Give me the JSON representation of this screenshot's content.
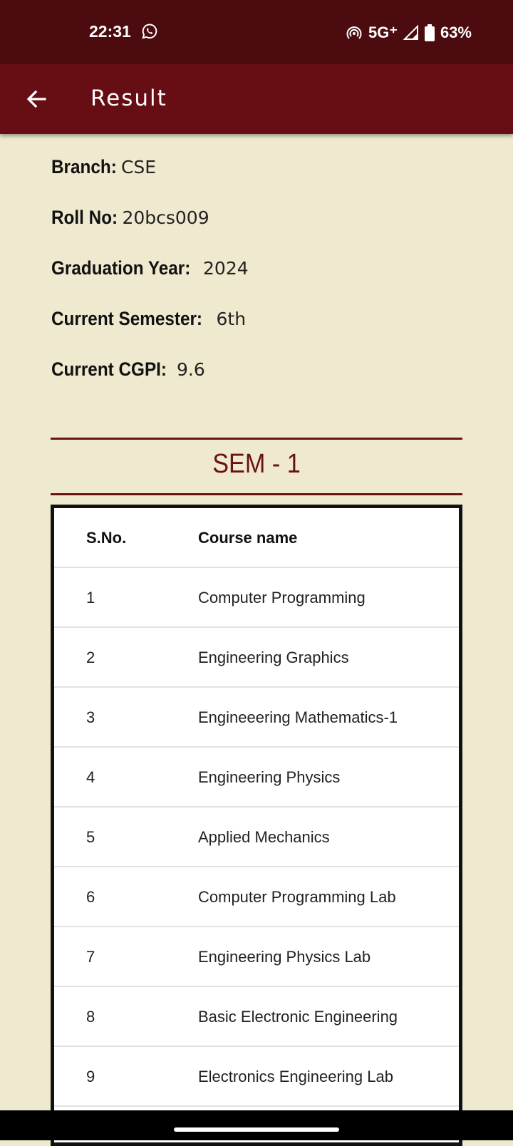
{
  "status_bar": {
    "time": "22:31",
    "network": "5G⁺",
    "battery": "63%",
    "icons": [
      "whatsapp-icon",
      "hotspot-icon",
      "signal-icon",
      "battery-icon"
    ]
  },
  "app_bar": {
    "title": "Result",
    "back_icon": "arrow-left-icon"
  },
  "student": {
    "branch_label": "Branch:",
    "branch": "CSE",
    "roll_label": "Roll No:",
    "roll": "20bcs009",
    "grad_label": "Graduation Year:",
    "grad": "2024",
    "sem_label": "Current Semester:",
    "sem": "6th",
    "cgpi_label": "Current CGPI:",
    "cgpi": "9.6"
  },
  "semester": {
    "title": "SEM  - 1",
    "columns": {
      "sno": "S.No.",
      "course": "Course name"
    },
    "rows": [
      {
        "sno": "1",
        "course": "Computer Programming"
      },
      {
        "sno": "2",
        "course": "Engineering Graphics"
      },
      {
        "sno": "3",
        "course": "Engineeering Mathematics-1"
      },
      {
        "sno": "4",
        "course": "Engineering Physics"
      },
      {
        "sno": "5",
        "course": "Applied Mechanics"
      },
      {
        "sno": "6",
        "course": "Computer Programming Lab"
      },
      {
        "sno": "7",
        "course": "Engineering Physics Lab"
      },
      {
        "sno": "8",
        "course": "Basic Electronic Engineering"
      },
      {
        "sno": "9",
        "course": "Electronics Engineering Lab"
      }
    ]
  },
  "colors": {
    "status_bar": "#4c0b0f",
    "app_bar": "#660e14",
    "background": "#efe9cf",
    "accent": "#6b1216"
  }
}
